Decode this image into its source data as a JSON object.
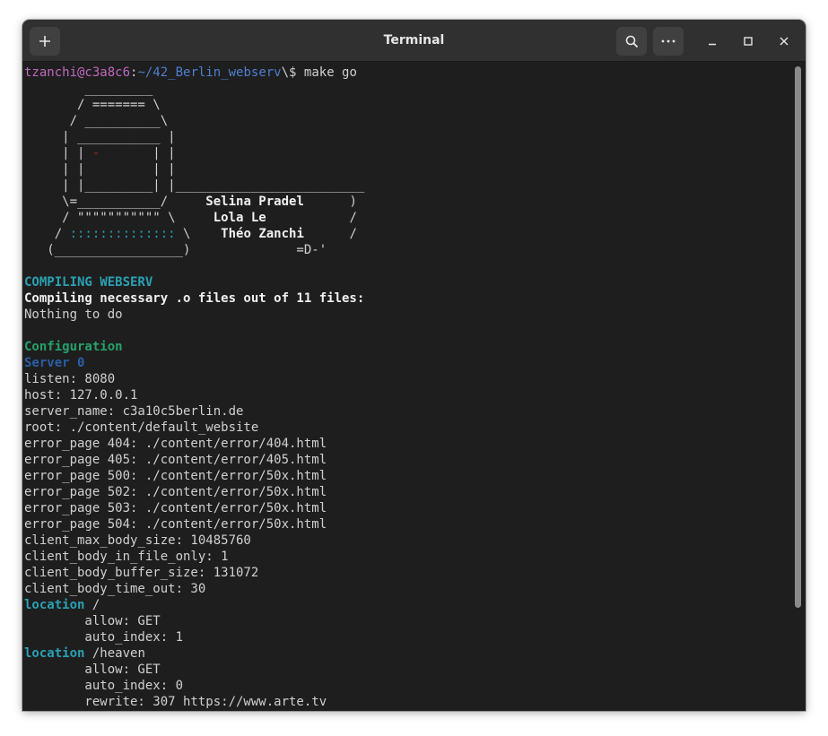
{
  "window": {
    "title": "Terminal"
  },
  "colors": {
    "background": "#1e1e1e",
    "foreground": "#d0d0d0",
    "prompt_user": "#c069c0",
    "prompt_path": "#4f7fd0",
    "cyan": "#2aa1b3",
    "green": "#26a269",
    "blue": "#2a5fa8",
    "red": "#c01c28"
  },
  "prompt": {
    "user_host": "tzanchi@c3a8c6",
    "colon": ":",
    "path": "~/42_Berlin_webserv",
    "symbol": "\\$ ",
    "command": "make go"
  },
  "ascii_art": {
    "line1": "        _________",
    "line2": "       / ======= \\",
    "line3": "      / __________\\",
    "line4": "     | ___________ |",
    "line5_a": "     | | ",
    "line5_red": "-",
    "line5_b": "       | |",
    "line6": "     | |         | |",
    "line7": "     | |_________| |_________________________",
    "line8_a": "     \\=___________/     ",
    "line8_name": "Selina Pradel",
    "line8_b": "      )",
    "line9_a": "     / \"\"\"\"\"\"\"\"\"\"\" \\     ",
    "line9_name": "Lola Le",
    "line9_b": "           /",
    "line10_a": "    / ",
    "line10_dots": "::::::::::::::",
    "line10_b": " \\    ",
    "line10_name": "Théo Zanchi",
    "line10_c": "      /",
    "line11": "   (_________________)              =D-'"
  },
  "output": {
    "compiling_header": "COMPILING WEBSERV",
    "compiling_line": "Compiling necessary .o files out of 11 files:",
    "nothing": "Nothing to do",
    "config_header": "Configuration",
    "server_header": "Server 0",
    "settings": [
      "listen: 8080",
      "host: 127.0.0.1",
      "server_name: c3a10c5berlin.de",
      "root: ./content/default_website",
      "error_page 404: ./content/error/404.html",
      "error_page 405: ./content/error/405.html",
      "error_page 500: ./content/error/50x.html",
      "error_page 502: ./content/error/50x.html",
      "error_page 503: ./content/error/50x.html",
      "error_page 504: ./content/error/50x.html",
      "client_max_body_size: 10485760",
      "client_body_in_file_only: 1",
      "client_body_buffer_size: 131072",
      "client_body_time_out: 30"
    ],
    "location1_keyword": "location",
    "location1_path": " /",
    "location1_lines": [
      "        allow: GET",
      "        auto_index: 1"
    ],
    "location2_keyword": "location",
    "location2_path": " /heaven",
    "location2_lines": [
      "        allow: GET",
      "        auto_index: 0",
      "        rewrite: 307 https://www.arte.tv"
    ]
  }
}
